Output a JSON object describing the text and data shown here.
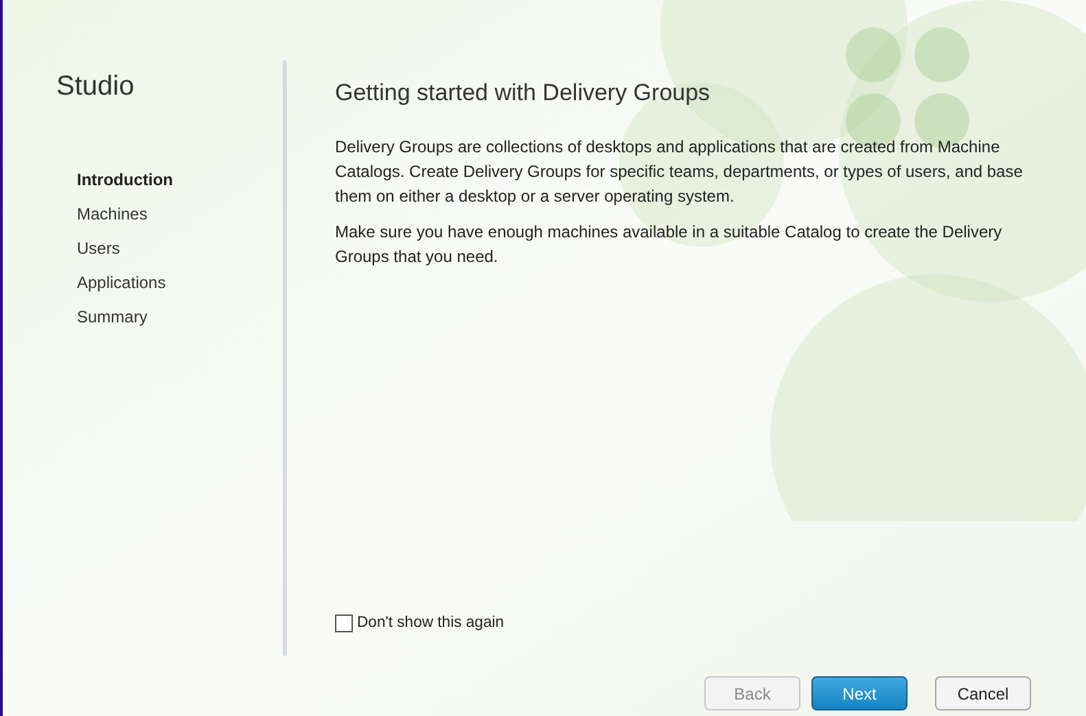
{
  "sidebar": {
    "title": "Studio",
    "items": [
      {
        "label": "Introduction",
        "selected": true
      },
      {
        "label": "Machines",
        "selected": false
      },
      {
        "label": "Users",
        "selected": false
      },
      {
        "label": "Applications",
        "selected": false
      },
      {
        "label": "Summary",
        "selected": false
      }
    ]
  },
  "heading": "Getting started with Delivery Groups",
  "paragraphs": [
    "Delivery Groups are collections of desktops and applications that are created from Machine Catalogs. Create Delivery Groups for specific teams, departments, or types of users, and base them on either a desktop or a server operating system.",
    "Make sure you have enough machines available in a suitable Catalog to create the Delivery Groups that you need."
  ],
  "dont_show_again": {
    "label": "Don't show this again",
    "checked": false
  },
  "buttons": [
    {
      "label": "Back",
      "kind": "secondary",
      "disabled": true
    },
    {
      "label": "Next",
      "kind": "primary",
      "disabled": false
    },
    {
      "label": "Cancel",
      "kind": "secondary",
      "disabled": false
    }
  ]
}
